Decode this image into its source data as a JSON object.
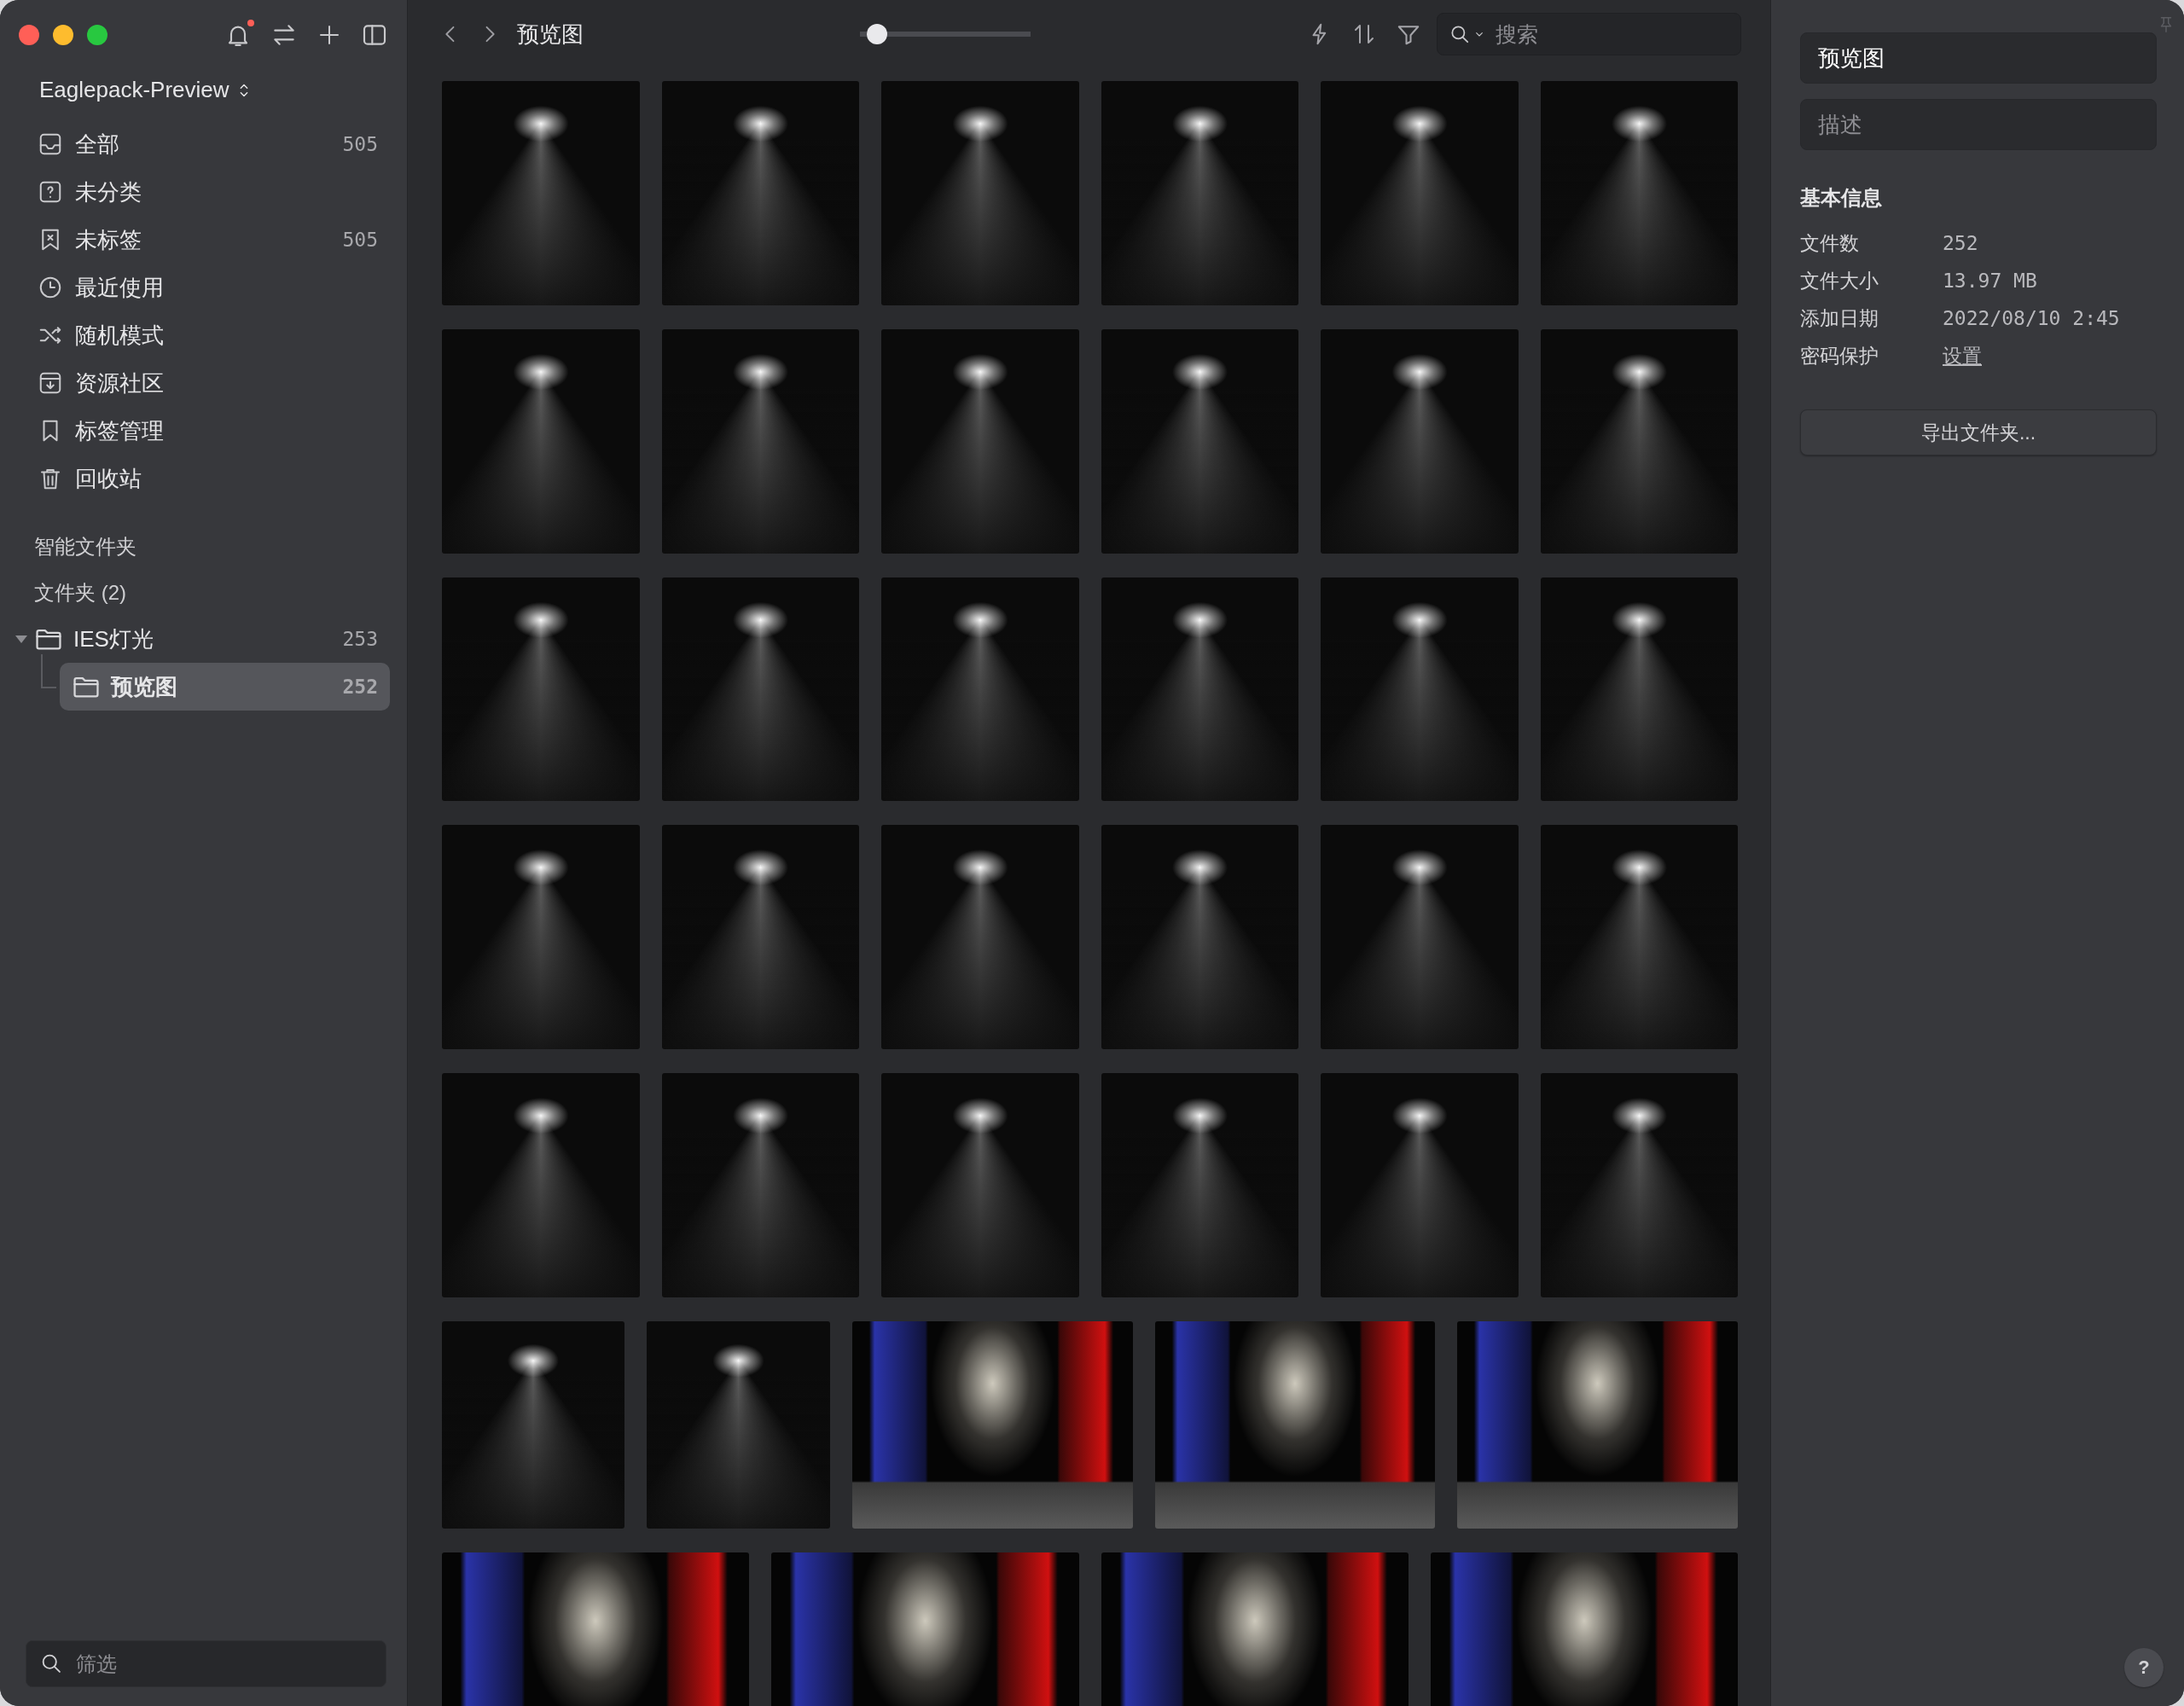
{
  "sidebar": {
    "notification": true,
    "library": "Eaglepack-Preview",
    "nav": [
      {
        "kind": "all",
        "label": "全部",
        "count": "505",
        "selected": false
      },
      {
        "kind": "uncategorized",
        "label": "未分类",
        "selected": false
      },
      {
        "kind": "untagged",
        "label": "未标签",
        "count": "505",
        "selected": false
      },
      {
        "kind": "recent",
        "label": "最近使用",
        "selected": false
      },
      {
        "kind": "random",
        "label": "随机模式",
        "selected": false
      },
      {
        "kind": "community",
        "label": "资源社区",
        "selected": false
      },
      {
        "kind": "tags",
        "label": "标签管理",
        "selected": false
      },
      {
        "kind": "trash",
        "label": "回收站",
        "selected": false
      }
    ],
    "smart_folders_label": "智能文件夹",
    "folders_label": "文件夹 (2)",
    "folders": [
      {
        "name": "IES灯光",
        "count": "253",
        "expanded": true,
        "selected": false,
        "children": [
          {
            "name": "预览图",
            "count": "252",
            "selected": true
          }
        ]
      }
    ],
    "filter": {
      "placeholder": "筛选"
    }
  },
  "toolbar": {
    "title": "预览图",
    "zoom": {
      "level": 0.1
    },
    "search": {
      "placeholder": "搜索"
    }
  },
  "grid": {
    "rows": [
      {
        "items": [
          {
            "kind": "spotlight"
          },
          {
            "kind": "spotlight"
          },
          {
            "kind": "spotlight"
          },
          {
            "kind": "spotlight"
          },
          {
            "kind": "spotlight"
          },
          {
            "kind": "spotlight"
          }
        ]
      },
      {
        "items": [
          {
            "kind": "spotlight"
          },
          {
            "kind": "spotlight"
          },
          {
            "kind": "spotlight"
          },
          {
            "kind": "spotlight"
          },
          {
            "kind": "spotlight"
          },
          {
            "kind": "spotlight"
          }
        ]
      },
      {
        "items": [
          {
            "kind": "spotlight"
          },
          {
            "kind": "spotlight"
          },
          {
            "kind": "spotlight"
          },
          {
            "kind": "spotlight"
          },
          {
            "kind": "spotlight"
          },
          {
            "kind": "spotlight"
          }
        ]
      },
      {
        "items": [
          {
            "kind": "spotlight"
          },
          {
            "kind": "spotlight"
          },
          {
            "kind": "spotlight"
          },
          {
            "kind": "spotlight"
          },
          {
            "kind": "spotlight"
          },
          {
            "kind": "spotlight"
          }
        ]
      },
      {
        "items": [
          {
            "kind": "spotlight"
          },
          {
            "kind": "spotlight"
          },
          {
            "kind": "spotlight"
          },
          {
            "kind": "spotlight"
          },
          {
            "kind": "spotlight"
          },
          {
            "kind": "spotlight"
          }
        ]
      },
      {
        "items": [
          {
            "kind": "spotlight"
          },
          {
            "kind": "spotlight"
          },
          {
            "kind": "room"
          },
          {
            "kind": "room"
          },
          {
            "kind": "room"
          }
        ]
      },
      {
        "items": [
          {
            "kind": "room"
          },
          {
            "kind": "room"
          },
          {
            "kind": "room"
          },
          {
            "kind": "room"
          }
        ]
      }
    ]
  },
  "inspector": {
    "name": {
      "value": "预览图"
    },
    "description": {
      "placeholder": "描述"
    },
    "section_title": "基本信息",
    "info": [
      {
        "kind": "text",
        "label": "文件数",
        "value": "252"
      },
      {
        "kind": "text",
        "label": "文件大小",
        "value": "13.97 MB"
      },
      {
        "kind": "text",
        "label": "添加日期",
        "value": "2022/08/10 2:45"
      },
      {
        "kind": "link",
        "label": "密码保护",
        "value": "设置"
      }
    ],
    "export_button": "导出文件夹...",
    "help_button": "?"
  }
}
